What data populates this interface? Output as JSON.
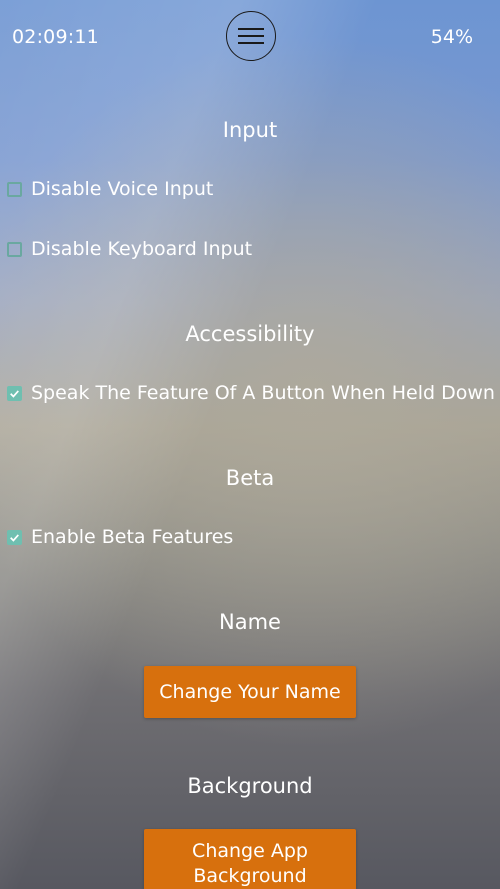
{
  "status_bar": {
    "time": "02:09:11",
    "battery": "54%",
    "menu_icon": "hamburger-menu-icon"
  },
  "sections": {
    "input": {
      "title": "Input",
      "options": [
        {
          "label": "Disable Voice Input",
          "checked": false
        },
        {
          "label": "Disable Keyboard Input",
          "checked": false
        }
      ]
    },
    "accessibility": {
      "title": "Accessibility",
      "options": [
        {
          "label": "Speak The Feature Of A Button When Held Down",
          "checked": true
        }
      ]
    },
    "beta": {
      "title": "Beta",
      "options": [
        {
          "label": "Enable Beta Features",
          "checked": true
        }
      ]
    },
    "name": {
      "title": "Name",
      "button_label": "Change Your Name"
    },
    "background": {
      "title": "Background",
      "button_label": "Change App Background"
    }
  },
  "colors": {
    "checkbox_accent": "#6fbfb0",
    "button_background": "#d7700d",
    "text": "#ffffff"
  }
}
